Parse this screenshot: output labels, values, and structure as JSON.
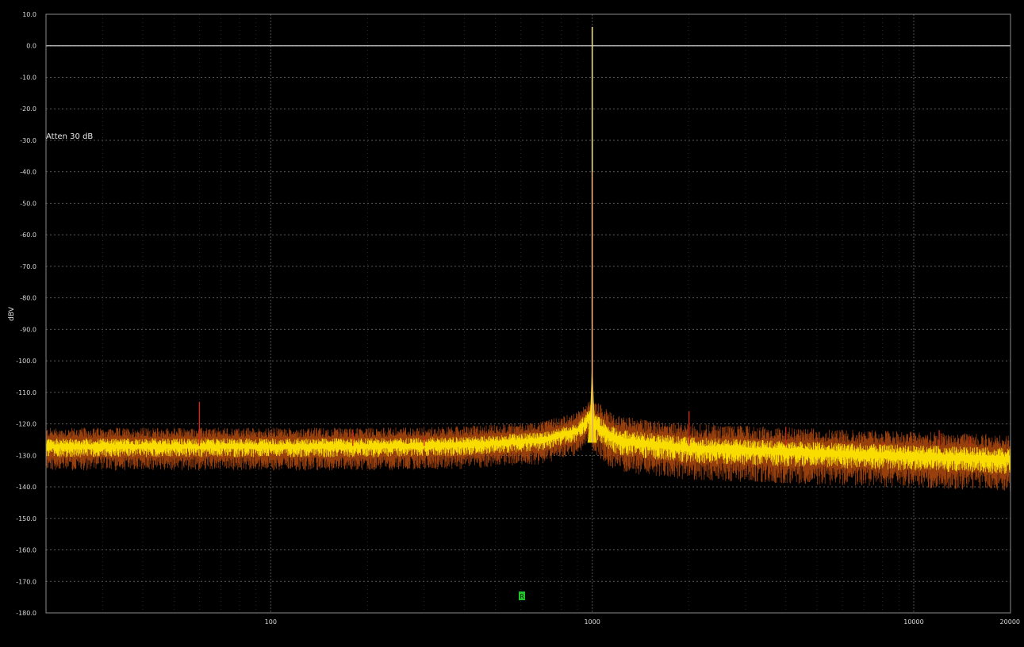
{
  "chart_data": {
    "type": "line",
    "title": "",
    "xlabel": "",
    "ylabel": "dBV",
    "x_scale": "log",
    "xlim": [
      20,
      20000
    ],
    "ylim": [
      -180,
      10
    ],
    "y_ticks": [
      10,
      0,
      -10,
      -20,
      -30,
      -40,
      -50,
      -60,
      -70,
      -80,
      -90,
      -100,
      -110,
      -120,
      -130,
      -140,
      -150,
      -160,
      -170,
      -180
    ],
    "y_tick_labels": [
      "10.0",
      "0.0",
      "-10.0",
      "-20.0",
      "-30.0",
      "-40.0",
      "-50.0",
      "-60.0",
      "-70.0",
      "-80.0",
      "-90.0",
      "-100.0",
      "-110.0",
      "-120.0",
      "-130.0",
      "-140.0",
      "-150.0",
      "-160.0",
      "-170.0",
      "-180.0"
    ],
    "x_ticks": [
      100,
      1000,
      10000,
      20000
    ],
    "x_tick_labels": [
      "100",
      "1000",
      "10000",
      "20000"
    ],
    "grid": true,
    "reference_level": 0,
    "annotation": "Atten 30 dB",
    "marker_label": "R",
    "colors": {
      "background": "#000000",
      "grid": "#5a5a5a",
      "frame": "#8a8a8a",
      "reference_line": "#c8c8c8",
      "noise": "#ffe600",
      "noise_dark": "#b34a10",
      "spur": "#cc2a1a",
      "fundamental": "#e8d890",
      "marker": "#22c22a"
    },
    "series": [
      {
        "name": "",
        "kind": "spectrum",
        "points": [
          {
            "x": 20,
            "y": -127
          },
          {
            "x": 50,
            "y": -127
          },
          {
            "x": 100,
            "y": -127
          },
          {
            "x": 200,
            "y": -127
          },
          {
            "x": 400,
            "y": -126.5
          },
          {
            "x": 700,
            "y": -125
          },
          {
            "x": 900,
            "y": -122
          },
          {
            "x": 980,
            "y": -118
          },
          {
            "x": 1000,
            "y": 6
          },
          {
            "x": 1020,
            "y": -120
          },
          {
            "x": 1200,
            "y": -125
          },
          {
            "x": 2000,
            "y": -127.5
          },
          {
            "x": 5000,
            "y": -129
          },
          {
            "x": 10000,
            "y": -130
          },
          {
            "x": 20000,
            "y": -131
          }
        ]
      }
    ],
    "spurs": [
      {
        "x": 60,
        "y": -113
      },
      {
        "x": 180,
        "y": -122
      },
      {
        "x": 300,
        "y": -124
      },
      {
        "x": 2000,
        "y": -116
      },
      {
        "x": 4000,
        "y": -121
      },
      {
        "x": 8000,
        "y": -126
      },
      {
        "x": 12000,
        "y": -122
      },
      {
        "x": 15000,
        "y": -124
      }
    ]
  }
}
